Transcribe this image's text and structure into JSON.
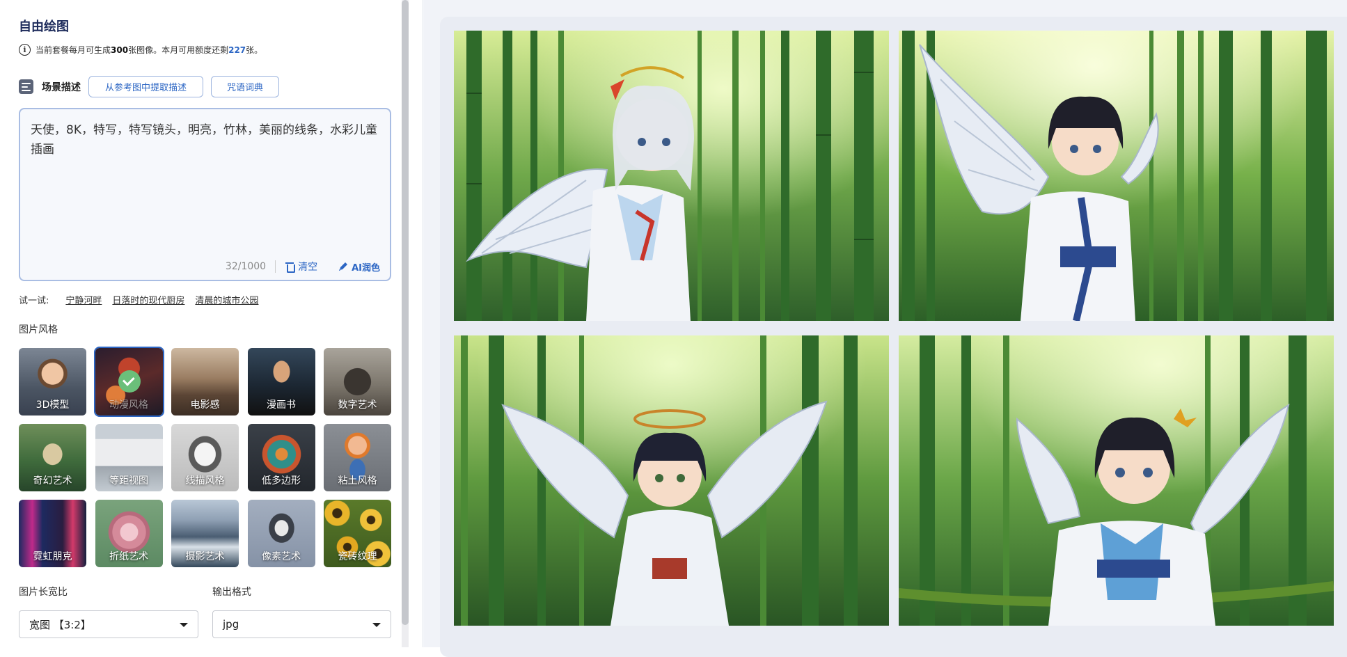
{
  "header": {
    "title": "自由绘图",
    "quota_prefix": "当前套餐每月可生成",
    "quota_total": "300",
    "quota_mid": "张图像。本月可用额度还剩",
    "quota_remaining": "227",
    "quota_suffix": "张。"
  },
  "scene": {
    "label": "场景描述",
    "extract_button": "从参考图中提取描述",
    "dictionary_button": "咒语词典"
  },
  "prompt": {
    "text": "天使，8K，特写，特写镜头，明亮，竹林，美丽的线条，水彩儿童插画",
    "counter": "32/1000",
    "clear_label": "清空",
    "ai_label": "AI润色"
  },
  "try": {
    "label": "试一试:",
    "suggestions": [
      "宁静河畔",
      "日落时的现代厨房",
      "清晨的城市公园"
    ]
  },
  "styles": {
    "title": "图片风格",
    "items": [
      {
        "label": "3D模型"
      },
      {
        "label": "动漫风格",
        "selected": true
      },
      {
        "label": "电影感"
      },
      {
        "label": "漫画书"
      },
      {
        "label": "数字艺术"
      },
      {
        "label": "奇幻艺术"
      },
      {
        "label": "等距视图"
      },
      {
        "label": "线描风格"
      },
      {
        "label": "低多边形"
      },
      {
        "label": "粘土风格"
      },
      {
        "label": "霓虹朋克"
      },
      {
        "label": "折纸艺术"
      },
      {
        "label": "摄影艺术"
      },
      {
        "label": "像素艺术"
      },
      {
        "label": "瓷砖纹理"
      }
    ]
  },
  "options": {
    "ratio_label": "图片长宽比",
    "ratio_value": "宽图 【3:2】",
    "format_label": "输出格式",
    "format_value": "jpg"
  },
  "colors": {
    "accent": "#2c66c4",
    "title": "#1c2a5a",
    "bamboo_dark": "#2f6b2a",
    "bamboo_light": "#b6d86a"
  }
}
